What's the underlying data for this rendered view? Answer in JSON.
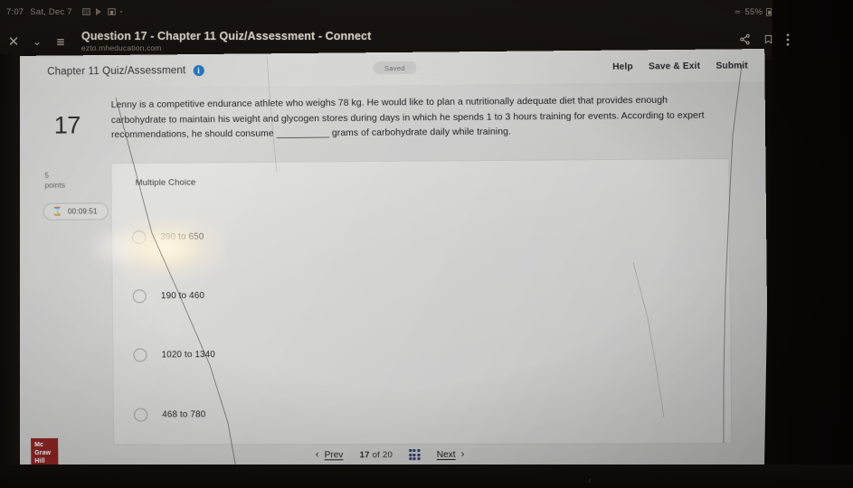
{
  "status_bar": {
    "time": "7:07",
    "date": "Sat, Dec 7",
    "battery_percent": "55%",
    "icons": [
      "calendar-icon",
      "cast-icon",
      "video-icon",
      "dot-icon"
    ]
  },
  "browser": {
    "close_label": "✕",
    "chevron_label": "⌄",
    "tabs_label": "≣",
    "page_title": "Question 17 - Chapter 11 Quiz/Assessment - Connect",
    "url": "ezto.mheducation.com",
    "share_label": "⟨",
    "bookmark_label": "☐",
    "overflow_label": "⋮"
  },
  "quiz_header": {
    "title": "Chapter 11 Quiz/Assessment",
    "info_glyph": "i",
    "saved_badge": "Saved",
    "actions": [
      "Help",
      "Save & Exit",
      "Submit"
    ]
  },
  "question": {
    "number": "17",
    "points_value": "5",
    "points_label": "points",
    "timer": "00:09:51",
    "timer_icon": "hourglass-icon",
    "type_label": "Multiple Choice",
    "text": "Lenny is a competitive endurance athlete who weighs 78 kg. He would like to plan a nutritionally adequate diet that provides enough carbohydrate to maintain his weight and glycogen stores during days in which he spends 1 to 3 hours training for events. According to expert recommendations, he should consume __________ grams of carbohydrate daily while training.",
    "options": [
      {
        "label": "390 to 650",
        "selected": false
      },
      {
        "label": "190 to 460",
        "selected": false
      },
      {
        "label": "1020 to 1340",
        "selected": false
      },
      {
        "label": "468 to 780",
        "selected": false
      }
    ]
  },
  "footer": {
    "prev_label": "Prev",
    "prev_chevron": "‹",
    "next_label": "Next",
    "next_chevron": "›",
    "current": "17",
    "of_label": "of",
    "total": "20",
    "grid_icon": "grid-icon",
    "logo_lines": [
      "Mc",
      "Graw",
      "Hill"
    ]
  },
  "colors": {
    "accent_blue": "#1a73c8",
    "logo_red": "#8c1d1d",
    "grid_blue": "#2f3f6b"
  }
}
